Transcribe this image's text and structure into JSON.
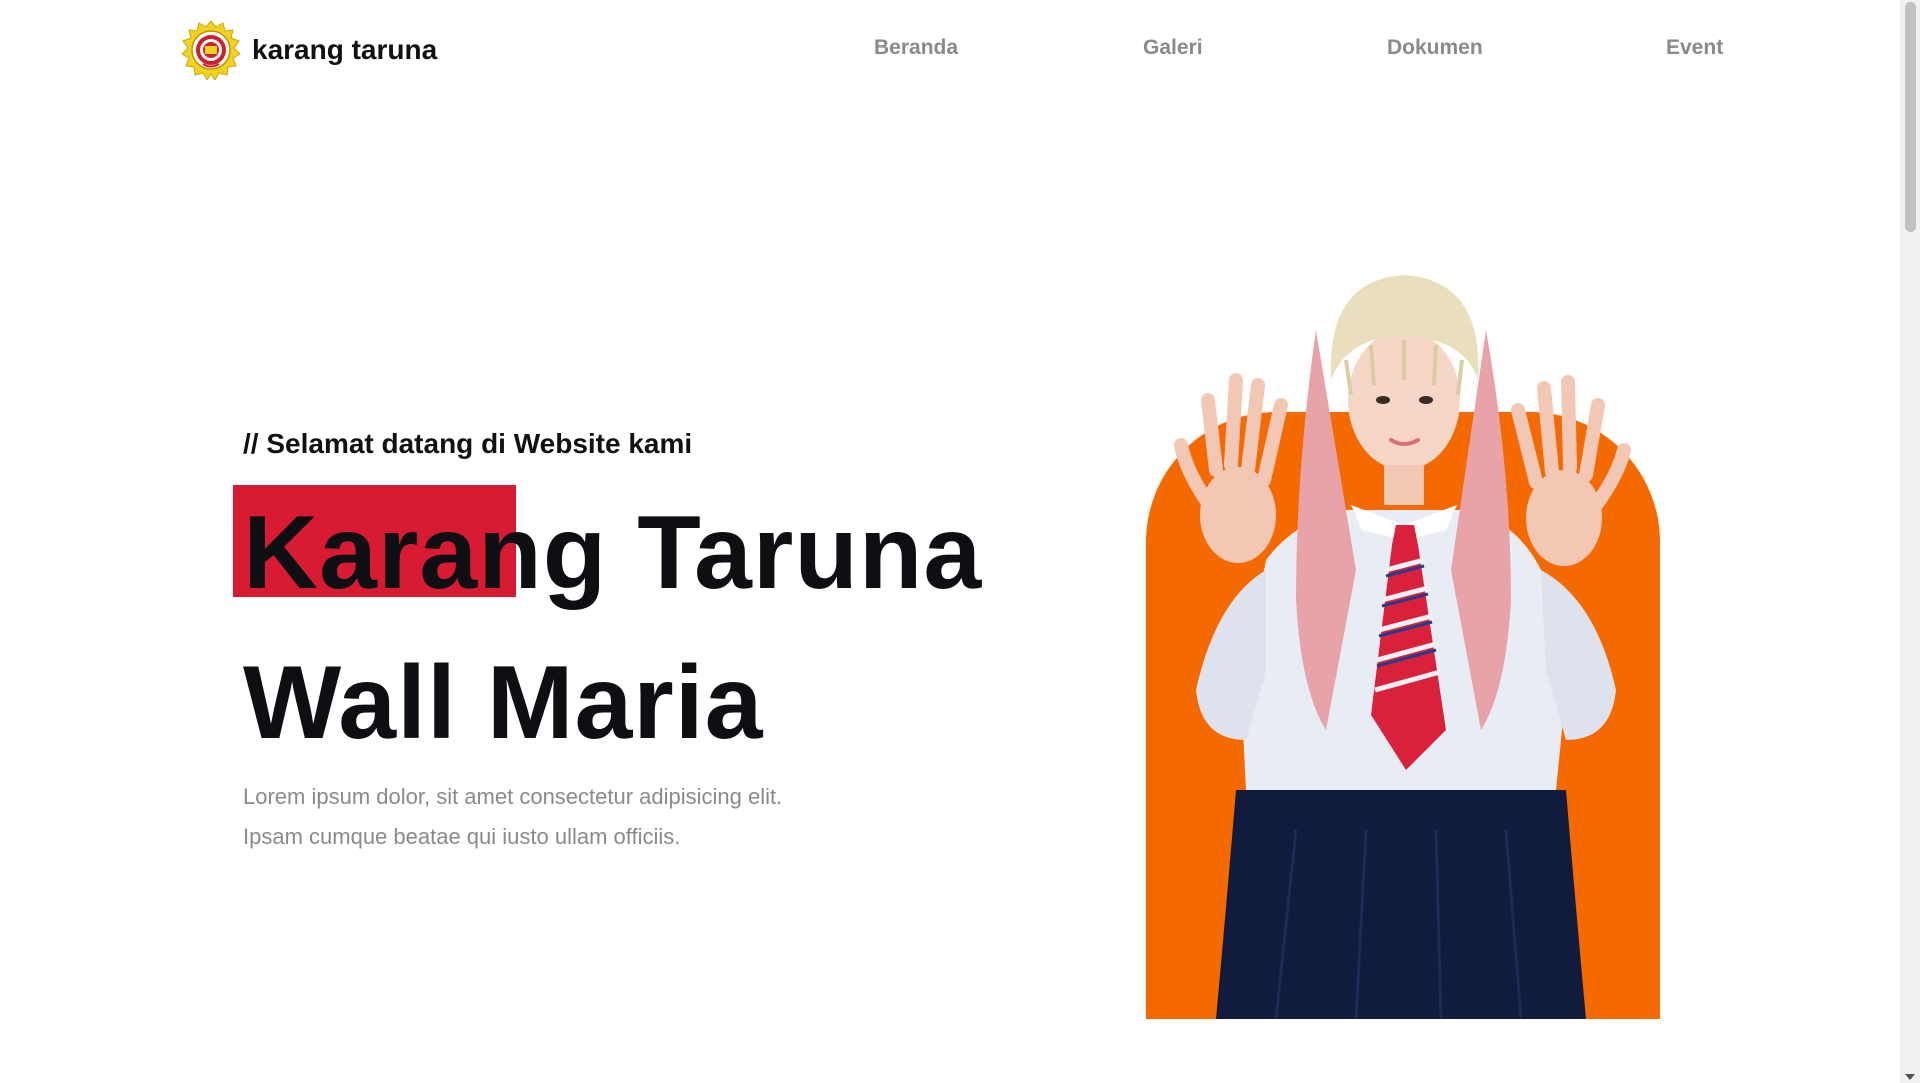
{
  "brand": {
    "name": "karang taruna",
    "logo_icon": "karang-taruna-emblem"
  },
  "nav": {
    "items": [
      {
        "label": "Beranda"
      },
      {
        "label": "Galeri"
      },
      {
        "label": "Dokumen"
      },
      {
        "label": "Event"
      }
    ]
  },
  "hero": {
    "subtitle": "// Selamat datang di Website kami",
    "title_line1": "Karang Taruna",
    "title_line2": "Wall Maria",
    "description": "Lorem ipsum dolor, sit amet consectetur adipisicing elit. Ipsam cumque beatae qui iusto ullam officiis."
  },
  "colors": {
    "highlight": "#d81b32",
    "accent_orange": "#f46a00",
    "title_text": "#0d0f12",
    "muted_text": "#8a8a8a"
  }
}
